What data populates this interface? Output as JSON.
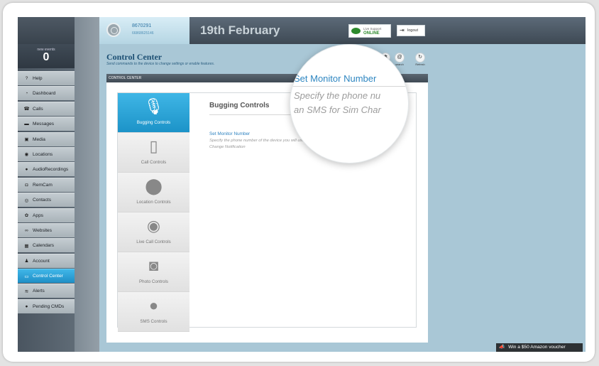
{
  "user": {
    "number": "8670291",
    "phone": "66868625146"
  },
  "header": {
    "date": "19th February",
    "live_support": "Live Support",
    "live_status": "ONLINE",
    "logout": "logout"
  },
  "events": {
    "label": "new events",
    "count": "0"
  },
  "sidebar": {
    "items": [
      {
        "label": "Help",
        "icon": "help-icon",
        "glyph": "?"
      },
      {
        "label": "Dashboard",
        "icon": "dashboard-icon",
        "glyph": "◔"
      },
      {
        "label": "Calls",
        "icon": "phone-icon",
        "glyph": "☎"
      },
      {
        "label": "Messages",
        "icon": "message-icon",
        "glyph": "▬"
      },
      {
        "label": "Media",
        "icon": "image-icon",
        "glyph": "▣"
      },
      {
        "label": "Locations",
        "icon": "location-icon",
        "glyph": "◉"
      },
      {
        "label": "AudioRecordings",
        "icon": "audio-icon",
        "glyph": "●"
      },
      {
        "label": "RemCam",
        "icon": "camera-icon",
        "glyph": "◘"
      },
      {
        "label": "Contacts",
        "icon": "contacts-icon",
        "glyph": "◎"
      },
      {
        "label": "Apps",
        "icon": "apps-icon",
        "glyph": "✿"
      },
      {
        "label": "Websites",
        "icon": "link-icon",
        "glyph": "∞"
      },
      {
        "label": "Calendars",
        "icon": "calendar-icon",
        "glyph": "▦"
      },
      {
        "label": "Account",
        "icon": "account-icon",
        "glyph": "♟"
      },
      {
        "label": "Control Center",
        "icon": "monitor-icon",
        "glyph": "▭"
      },
      {
        "label": "Alerts",
        "icon": "alert-icon",
        "glyph": "≋"
      },
      {
        "label": "Pending CMDs",
        "icon": "pending-icon",
        "glyph": "●"
      }
    ],
    "active_index": 13
  },
  "page": {
    "title": "Control Center",
    "subtitle": "Send commands to the device to change settings or enable features.",
    "section_header": "CONTROL CENTER",
    "tools": [
      {
        "label": "Settings"
      },
      {
        "label": "search"
      },
      {
        "label": "Refresh"
      }
    ]
  },
  "tabs": [
    {
      "label": "Bugging Controls",
      "icon": "microphone-icon",
      "glyph": "🎙"
    },
    {
      "label": "Call Controls",
      "icon": "mobile-phone-icon",
      "glyph": "▯"
    },
    {
      "label": "Location Controls",
      "icon": "map-pin-icon",
      "glyph": "⬤"
    },
    {
      "label": "Live Call Controls",
      "icon": "eye-icon",
      "glyph": "◉"
    },
    {
      "label": "Photo Controls",
      "icon": "photo-camera-icon",
      "glyph": "◙"
    },
    {
      "label": "SMS Controls",
      "icon": "speech-bubble-icon",
      "glyph": "●"
    }
  ],
  "content": {
    "title": "Bugging Controls",
    "link": "Set Monitor Number",
    "description": "Specify the phone number of the device you will use to make spy calls and/or receive an SMS for Sim Change Notification"
  },
  "magnifier": {
    "title": "Set Monitor Number",
    "desc_line1": "Specify the phone nu",
    "desc_line2": "an SMS for Sim Char"
  },
  "voucher": {
    "text": "Win a $50 Amazon voucher",
    "icon": "megaphone-icon"
  },
  "colors": {
    "accent": "#2a9fd6",
    "link": "#2f83c0",
    "online": "#2d8a2d"
  }
}
